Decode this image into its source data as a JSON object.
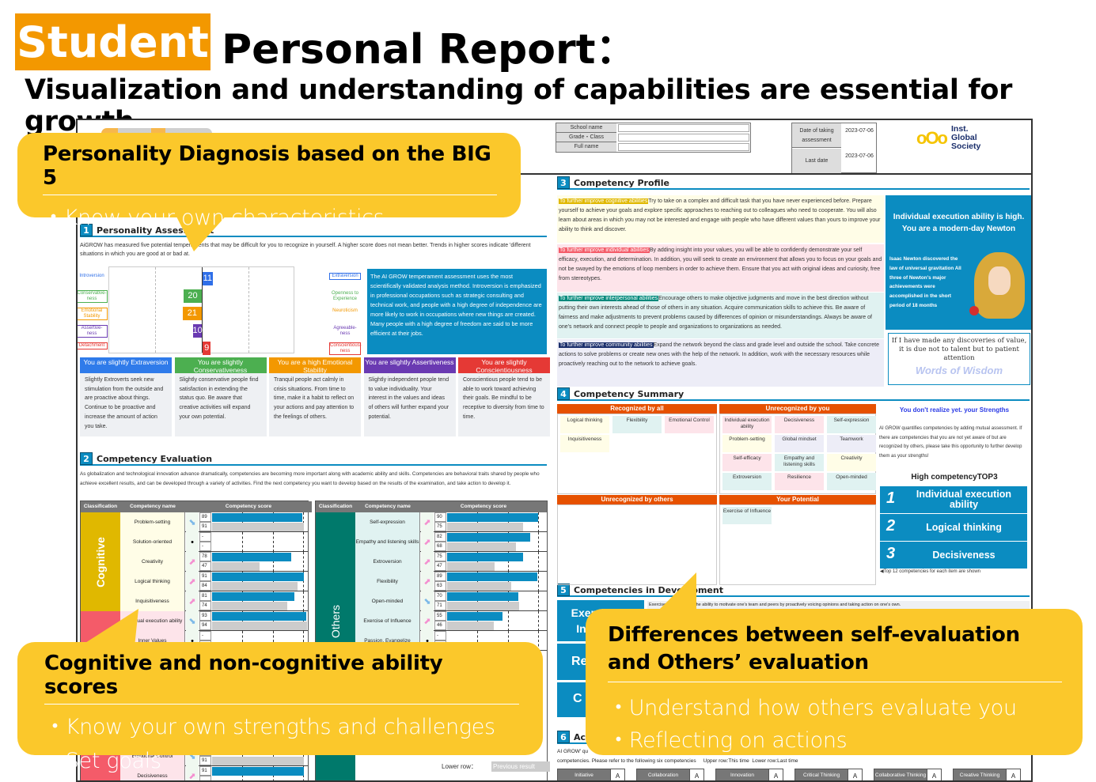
{
  "header": {
    "badge": "Student",
    "title": "Personal Report：",
    "subtitle": "Visualization and understanding of capabilities are essential for growth"
  },
  "colors": {
    "accent_orange": "#F39800",
    "callout_yellow": "#FBC82B",
    "report_blue": "#0B8CC1"
  },
  "report": {
    "info": {
      "school_label": "School name",
      "grade_label": "Grade・Class",
      "name_label": "Full name",
      "date_label": "Date of taking assessment",
      "date_value": "2023-07-06",
      "last_label": "Last date",
      "last_value": "2023-07-06",
      "org": "Inst. Global Society"
    },
    "s1": {
      "num": "1",
      "title": "Personality Assessment",
      "intro": "AiGROW has measured five potential temperaments that may be difficult for you to recognize in yourself. A higher score does not mean better. Trends in higher scores indicate 'different situations in which you are good at or bad at.",
      "traits": [
        {
          "left": "Introversion",
          "right": "Extraversion",
          "value": 11,
          "side": "right",
          "color": "#2F6FE8"
        },
        {
          "left": "Conservative-ness",
          "right": "Openness to Experience",
          "value": 20,
          "side": "left",
          "color": "#4CAF50"
        },
        {
          "left": "Emotional Stability",
          "right": "Neuroticism",
          "value": 21,
          "side": "left",
          "color": "#F39800"
        },
        {
          "left": "Assertive-ness",
          "right": "Agreeable-ness",
          "value": 10,
          "side": "left",
          "color": "#6A3AB2"
        },
        {
          "left": "Detachment",
          "right": "Conscientious-ness",
          "value": 9,
          "side": "right",
          "color": "#E53935"
        }
      ],
      "note": "The AI GROW temperament assessment uses the most scientifically validated analysis method. Introversion is emphasized in professional occupations such as strategic consulting and technical work, and people with a high degree of independence are more likely to work in occupations where new things are created. Many people with a high degree of freedom are said to be more efficient at their jobs.",
      "cards": [
        {
          "title": "You are slightly Extraversion",
          "color": "#2F7BEA",
          "text": "Slightly Extroverts seek new stimulation from the outside and are proactive about things. Continue to be proactive and increase the amount of action you take."
        },
        {
          "title": "You are slightly Conservativeness",
          "color": "#4CAF50",
          "text": "Slightly conservative people find satisfaction in extending the status quo. Be aware that creative activities will expand your own potential."
        },
        {
          "title": "You are a high Emotional Stability",
          "color": "#F39800",
          "text": "Tranquil people act calmly in crisis situations. From time to time, make it a habit to reflect on your actions and pay attention to the feelings of others."
        },
        {
          "title": "You are slightly Assertiveness",
          "color": "#6A3AB2",
          "text": "Slightly independent people tend to value individuality. Your interest in the values and ideas of others will further expand your potential."
        },
        {
          "title": "You are slightly Conscientiousness",
          "color": "#E53935",
          "text": "Conscientious people tend to be able to work toward achieving their goals. Be mindful to be receptive to diversity from time to time."
        }
      ]
    },
    "s2": {
      "num": "2",
      "title": "Competency Evaluation",
      "intro": "As globalization and technological innovation advance dramatically, competencies are becoming more important along with academic ability and skills. Competencies are behavioral traits shared by people who achieve excellent results, and can be developed through a variety of activities. Find the next competency you want to develop based on the results of the examination, and take action to develop it.",
      "headers": [
        "Classification",
        "Competency name",
        "Competency score"
      ],
      "left_groups": [
        {
          "label": "Cognitive",
          "color": "#E0B800"
        },
        {
          "label": "",
          "color": "#F45B69"
        }
      ],
      "left_rows": [
        {
          "name": "Problem-setting",
          "trend": "down",
          "now": "89",
          "prev": "91",
          "bg": "#FFFDE7"
        },
        {
          "name": "Solution-oriented",
          "trend": "none",
          "now": "-",
          "prev": "-",
          "bg": "#FFFDE7"
        },
        {
          "name": "Creativity",
          "trend": "up",
          "now": "78",
          "prev": "47",
          "bg": "#FFFDE7"
        },
        {
          "name": "Logical thinking",
          "trend": "up",
          "now": "91",
          "prev": "84",
          "bg": "#FFFDE7"
        },
        {
          "name": "Inquisitiveness",
          "trend": "up",
          "now": "81",
          "prev": "74",
          "bg": "#FFFDE7"
        },
        {
          "name": "Individual execution ability",
          "trend": "down",
          "now": "93",
          "prev": "94",
          "bg": "#FDE4EA"
        },
        {
          "name": "Inner Values",
          "trend": "none",
          "now": "-",
          "prev": "",
          "bg": "#FDE4EA"
        }
      ],
      "left_bottom_rows": [
        {
          "name": "Emotional Control",
          "trend": "down",
          "now": "",
          "prev": "91",
          "bg": "#FDE4EA"
        },
        {
          "name": "Decisiveness",
          "trend": "up",
          "now": "91",
          "prev": "",
          "bg": "#FDE4EA"
        }
      ],
      "right_group": {
        "label": "Others",
        "color": "#00796B"
      },
      "right_rows": [
        {
          "name": "Self-expression",
          "trend": "up",
          "now": "90",
          "prev": "75",
          "bg": "#E0F2F1"
        },
        {
          "name": "Empathy and listening skills",
          "trend": "up",
          "now": "82",
          "prev": "68",
          "bg": "#E0F2F1"
        },
        {
          "name": "Extroversion",
          "trend": "up",
          "now": "75",
          "prev": "47",
          "bg": "#E0F2F1"
        },
        {
          "name": "Flexibility",
          "trend": "up",
          "now": "89",
          "prev": "63",
          "bg": "#E0F2F1"
        },
        {
          "name": "Open-minded",
          "trend": "down",
          "now": "70",
          "prev": "71",
          "bg": "#E0F2F1"
        },
        {
          "name": "Exercise of Influence",
          "trend": "up",
          "now": "55",
          "prev": "46",
          "bg": "#E0F2F1"
        },
        {
          "name": "Passion, Evangelize",
          "trend": "none",
          "now": "-",
          "prev": "",
          "bg": "#E0F2F1"
        }
      ],
      "legend_lower": "Lower row：",
      "legend_prev": "Previous result"
    },
    "s3": {
      "num": "3",
      "title": "Competency Profile",
      "blocks": [
        {
          "tag": "To further improve cognitive abilities",
          "tagcolor": "#E0B800",
          "bg": "#FFFDE7",
          "text": "Try to take on a complex and difficult task that you have never experienced before. Prepare yourself to achieve your goals and explore specific approaches to reaching out to colleagues who need to cooperate. You will also learn about areas in which you may not be interested and engage with people who have different values than yours to improve your ability to think and discover."
        },
        {
          "tag": "To further improve individual abilities",
          "tagcolor": "#F45B69",
          "bg": "#FDE4EA",
          "text": "By adding insight into your values, you will be able to confidently demonstrate your self efficacy, execution, and determination. In addition, you will seek to create an environment that allows you to focus on your goals and not be swayed by the emotions of loop members in order to achieve them. Ensure that you act with original ideas and curiosity, free from stereotypes."
        },
        {
          "tag": "To further improve interpersonal abilities",
          "tagcolor": "#00897B",
          "bg": "#E0F2F1",
          "text": "Encourage others to make objective judgments and move in the best direction without putting their own interests ahead of those of others in any situation. Acquire communication skills to achieve this. Be aware of fairness and make adjustments to prevent problems caused by differences of opinion or misunderstandings. Always be aware of one's network and connect people to people and organizations to organizations as needed."
        },
        {
          "tag": "To further improve community abilities",
          "tagcolor": "#1A2E6B",
          "bg": "#EDEDF7",
          "text": "Expand the network beyond the class and grade level and outside the school. Take concrete actions to solve problems or create new ones with the help of the network. In addition, work with the necessary resources while proactively reaching out to the network to achieve goals."
        }
      ],
      "newton_title": "Individual execution ability is high. You are a modern-day Newton",
      "newton_text": "Isaac Newton discovered the law of universal gravitation All three of Newton's major achievements were accomplished in the short period of 18 months",
      "quote": "If I have made any discoveries of value, it is due not to talent but to patient attention",
      "quote_label": "Words of Wisdom"
    },
    "s4": {
      "num": "4",
      "title": "Competency Summary",
      "recognized_all": {
        "title": "Recognized by all",
        "items": [
          {
            "t": "Logical thinking",
            "c": "#FFFDE7"
          },
          {
            "t": "Flexibility",
            "c": "#E0F2F1"
          },
          {
            "t": "Emotional Control",
            "c": "#FDE4EA"
          },
          {
            "t": "Inquisitiveness",
            "c": "#FFFDE7"
          }
        ]
      },
      "unrecognized_you": {
        "title": "Unrecognized by you",
        "items": [
          {
            "t": "Individual execution ability",
            "c": "#FDE4EA"
          },
          {
            "t": "Decisiveness",
            "c": "#FDE4EA"
          },
          {
            "t": "Self-expression",
            "c": "#E0F2F1"
          },
          {
            "t": "Problem-setting",
            "c": "#FFFDE7"
          },
          {
            "t": "Global mindset",
            "c": "#EDEDF7"
          },
          {
            "t": "Teamwork",
            "c": "#EDEDF7"
          },
          {
            "t": "Self-efficacy",
            "c": "#FDE4EA"
          },
          {
            "t": "Empathy and listening skills",
            "c": "#E0F2F1"
          },
          {
            "t": "Creativity",
            "c": "#FFFDE7"
          },
          {
            "t": "Extroversion",
            "c": "#E0F2F1"
          },
          {
            "t": "Resilience",
            "c": "#FDE4EA"
          },
          {
            "t": "Open-minded",
            "c": "#E0F2F1"
          }
        ]
      },
      "unrecognized_others": {
        "title": "Unrecognized by others",
        "items": []
      },
      "potential": {
        "title": "Your Potential",
        "items": [
          {
            "t": "Exercise of Influence",
            "c": "#E0F2F1"
          }
        ]
      },
      "side_title": "You don't realize yet. your Strengths",
      "side_text": "AI GROW quantifies competencies by adding mutual assessment. If there are competencies that you are not yet aware of but are recognized by others, please take this opportunity to further develop them as your strengths!",
      "top3_title": "High competencyTOP3",
      "top3": [
        {
          "rank": "1",
          "name": "Individual execution ability"
        },
        {
          "rank": "2",
          "name": "Logical thinking"
        },
        {
          "rank": "3",
          "name": "Decisiveness"
        }
      ],
      "top_note": "◀Top 12 competencies for each item are shown"
    },
    "s5": {
      "num": "5",
      "title": "Competencies in Development",
      "buttons": [
        "Exercise of Influence",
        "Re",
        "C"
      ],
      "text": "Exercise of Influence is the ability to motivate one's team and peers by proactively voicing opinions and taking action on one's own."
    },
    "s6": {
      "num": "6",
      "title": "Ac",
      "text1": "AI GROW' qu",
      "text2": "competencies. Please refer to the following six competencies     Upper row:This time  Lower row:Last time",
      "grades": [
        {
          "l": "Initiative",
          "g": "A"
        },
        {
          "l": "Collaboration",
          "g": "A"
        },
        {
          "l": "Innovation",
          "g": "A"
        },
        {
          "l": "Critical Thinking",
          "g": "A"
        },
        {
          "l": "Collaborative Thinking",
          "g": "A"
        },
        {
          "l": "Creative Thinking",
          "g": "A"
        }
      ]
    }
  },
  "callouts": [
    {
      "title": "Personality Diagnosis based on the BIG 5",
      "bullets": [
        "・Know your own characteristics"
      ]
    },
    {
      "title": "Cognitive and non-cognitive ability scores",
      "bullets": [
        "・Know your own strengths and challenges",
        "・Set goals"
      ]
    },
    {
      "title": "Differences between self-evaluation and Others’ evaluation",
      "bullets": [
        "・Understand how others evaluate you",
        "・Reflecting on actions"
      ]
    }
  ]
}
